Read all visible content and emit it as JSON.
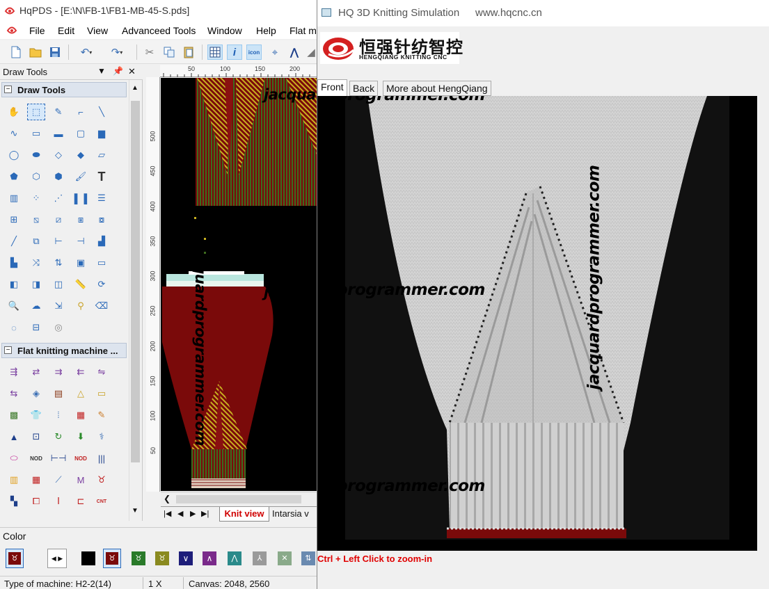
{
  "main_window": {
    "title": "HqPDS - [E:\\N\\FB-1\\FB1-MB-45-S.pds]",
    "menu": [
      "File",
      "Edit",
      "View",
      "Advanceed Tools",
      "Window",
      "Help",
      "Flat m"
    ],
    "dock_title": "Draw Tools",
    "draw_tools_group": "Draw Tools",
    "flat_group": "Flat knitting machine ...",
    "ruler_h": [
      "50",
      "100",
      "150",
      "200"
    ],
    "ruler_v": [
      "500",
      "450",
      "400",
      "350",
      "300",
      "250",
      "200",
      "150",
      "100",
      "50"
    ],
    "sheet_tabs": {
      "active": "Knit view",
      "other": "Intarsia v"
    },
    "color_label": "Color",
    "status": {
      "machine": "Type of machine: H2-2(14)",
      "zoom": "1 X",
      "canvas": "Canvas: 2048, 2560"
    }
  },
  "sim_window": {
    "title": "HQ 3D Knitting Simulation",
    "url": "www.hqcnc.cn",
    "logo_cn": "恒强针纺智控",
    "logo_en": "HENGQIANG KNITTING CNC",
    "tabs": [
      "Front",
      "Back",
      "More about HengQiang"
    ],
    "hint": "Ctrl + Left Click to zoom-in"
  },
  "watermark": "jacquardprogrammer.com",
  "colors": {
    "knit_red": "#7a0a0a",
    "stripe_green": "#3d6b1e",
    "fabric": "#d8d8d8",
    "accent": "#2a69b8"
  }
}
